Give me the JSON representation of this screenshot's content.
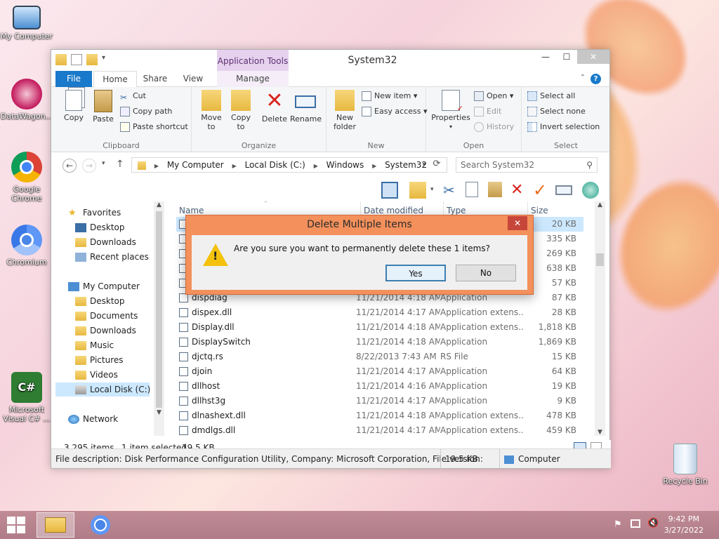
{
  "desktop": {
    "icons": [
      {
        "label": "My Computer"
      },
      {
        "label": "DataWagon..."
      },
      {
        "label": "Google Chrome"
      },
      {
        "label": "Chromium"
      },
      {
        "label": "Microsoft Visual C# ..."
      },
      {
        "label": "Recycle Bin"
      }
    ]
  },
  "window": {
    "title": "System32",
    "contextual_tab": "Application Tools",
    "tabs": {
      "file": "File",
      "home": "Home",
      "share": "Share",
      "view": "View",
      "manage": "Manage"
    },
    "ribbon": {
      "clipboard": {
        "label": "Clipboard",
        "copy": "Copy",
        "paste": "Paste",
        "cut": "Cut",
        "copy_path": "Copy path",
        "paste_shortcut": "Paste shortcut"
      },
      "organize": {
        "label": "Organize",
        "move_to": "Move",
        "move_to2": "to",
        "copy_to": "Copy",
        "copy_to2": "to",
        "delete": "Delete",
        "rename": "Rename"
      },
      "new": {
        "label": "New",
        "new_folder": "New",
        "new_folder2": "folder",
        "new_item": "New item",
        "easy_access": "Easy access"
      },
      "open": {
        "label": "Open",
        "properties": "Properties",
        "open": "Open",
        "edit": "Edit",
        "history": "History"
      },
      "select": {
        "label": "Select",
        "select_all": "Select all",
        "select_none": "Select none",
        "invert": "Invert selection"
      }
    },
    "address": {
      "crumbs": [
        "My Computer",
        "Local Disk (C:)",
        "Windows",
        "System32"
      ],
      "search_placeholder": "Search System32"
    },
    "nav": {
      "favorites": "Favorites",
      "fav_items": [
        "Desktop",
        "Downloads",
        "Recent places"
      ],
      "my_computer": "My Computer",
      "pc_items": [
        "Desktop",
        "Documents",
        "Downloads",
        "Music",
        "Pictures",
        "Videos",
        "Local Disk (C:)"
      ],
      "network": "Network"
    },
    "columns": {
      "name": "Name",
      "date": "Date modified",
      "type": "Type",
      "size": "Size"
    },
    "files": [
      {
        "name": "",
        "date": "",
        "type": "",
        "size": "20 KB"
      },
      {
        "name": "",
        "date": "",
        "type": "",
        "size": "335 KB"
      },
      {
        "name": "",
        "date": "",
        "type": "",
        "size": "269 KB"
      },
      {
        "name": "",
        "date": "",
        "type": "",
        "size": "638 KB"
      },
      {
        "name": "",
        "date": "",
        "type": "",
        "size": "57 KB"
      },
      {
        "name": "dispdiag",
        "date": "11/21/2014 4:18 AM",
        "type": "Application",
        "size": "87 KB"
      },
      {
        "name": "dispex.dll",
        "date": "11/21/2014 4:17 AM",
        "type": "Application extens...",
        "size": "28 KB"
      },
      {
        "name": "Display.dll",
        "date": "11/21/2014 4:18 AM",
        "type": "Application extens...",
        "size": "1,818 KB"
      },
      {
        "name": "DisplaySwitch",
        "date": "11/21/2014 4:18 AM",
        "type": "Application",
        "size": "1,869 KB"
      },
      {
        "name": "djctq.rs",
        "date": "8/22/2013 7:43 AM",
        "type": "RS File",
        "size": "15 KB"
      },
      {
        "name": "djoin",
        "date": "11/21/2014 4:17 AM",
        "type": "Application",
        "size": "64 KB"
      },
      {
        "name": "dllhost",
        "date": "11/21/2014 4:16 AM",
        "type": "Application",
        "size": "19 KB"
      },
      {
        "name": "dllhst3g",
        "date": "11/21/2014 4:17 AM",
        "type": "Application",
        "size": "9 KB"
      },
      {
        "name": "dlnashext.dll",
        "date": "11/21/2014 4:18 AM",
        "type": "Application extens...",
        "size": "478 KB"
      },
      {
        "name": "dmdlgs.dll",
        "date": "11/21/2014 4:17 AM",
        "type": "Application extens...",
        "size": "459 KB"
      }
    ],
    "status": {
      "count": "3,295 items",
      "selected": "1 item selected",
      "size": "19.5 KB"
    },
    "description": {
      "text": "File description: Disk Performance Configuration Utility, Company: Microsoft Corporation, File version:",
      "size": "19.5 KB",
      "location": "Computer"
    }
  },
  "dialog": {
    "title": "Delete Multiple Items",
    "message": "Are you sure you want to permanently delete these 1 items?",
    "yes": "Yes",
    "no": "No"
  },
  "taskbar": {
    "time": "9:42 PM",
    "date": "3/27/2022"
  }
}
